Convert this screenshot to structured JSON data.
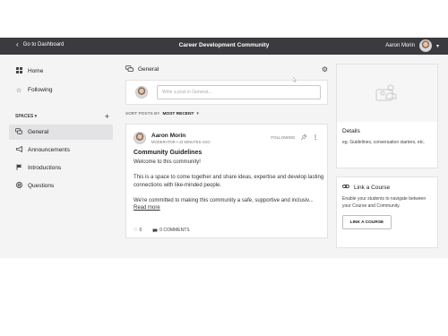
{
  "topbar": {
    "back_label": "Go to Dashboard",
    "title": "Career Development Community",
    "user_name": "Aaron Morin"
  },
  "sidebar": {
    "top_items": [
      {
        "label": "Home",
        "icon": "home-grid-icon"
      },
      {
        "label": "Following",
        "icon": "star-icon"
      }
    ],
    "spaces_label": "SPACES",
    "spaces": [
      {
        "label": "General",
        "icon": "chat-bubbles-icon",
        "active": true
      },
      {
        "label": "Announcements",
        "icon": "megaphone-icon"
      },
      {
        "label": "Introductions",
        "icon": "flag-icon"
      },
      {
        "label": "Questions",
        "icon": "lifebuoy-icon"
      }
    ]
  },
  "main": {
    "space_title": "General",
    "composer_placeholder": "Write a post in General...",
    "sort_label": "SORT POSTS BY",
    "sort_value": "MOST RECENT",
    "post": {
      "author": "Aaron Morin",
      "role": "MODERATOR",
      "time": "43 MINUTES AGO",
      "following_label": "FOLLOWING",
      "title": "Community Guidelines",
      "paragraphs": [
        "Welcome to this community!",
        "This is a space to come together and share ideas, expertise and develop lasting connections with like-minded people.",
        "We're committed to making this community a safe, supportive and inclusiv..."
      ],
      "read_more": "Read more",
      "likes": "0",
      "comments": "0 COMMENTS"
    }
  },
  "right": {
    "details_title": "Details",
    "details_text": "eg. Guidelines, conversation starters, etc.",
    "link_title": "Link a Course",
    "link_text": "Enable your students to navigate between your Course and Community.",
    "link_button": "LINK A COURSE"
  },
  "colors": {
    "topbar": "#3b3b3f",
    "background": "#f4f4f5",
    "active_item": "#e3e3e6"
  }
}
